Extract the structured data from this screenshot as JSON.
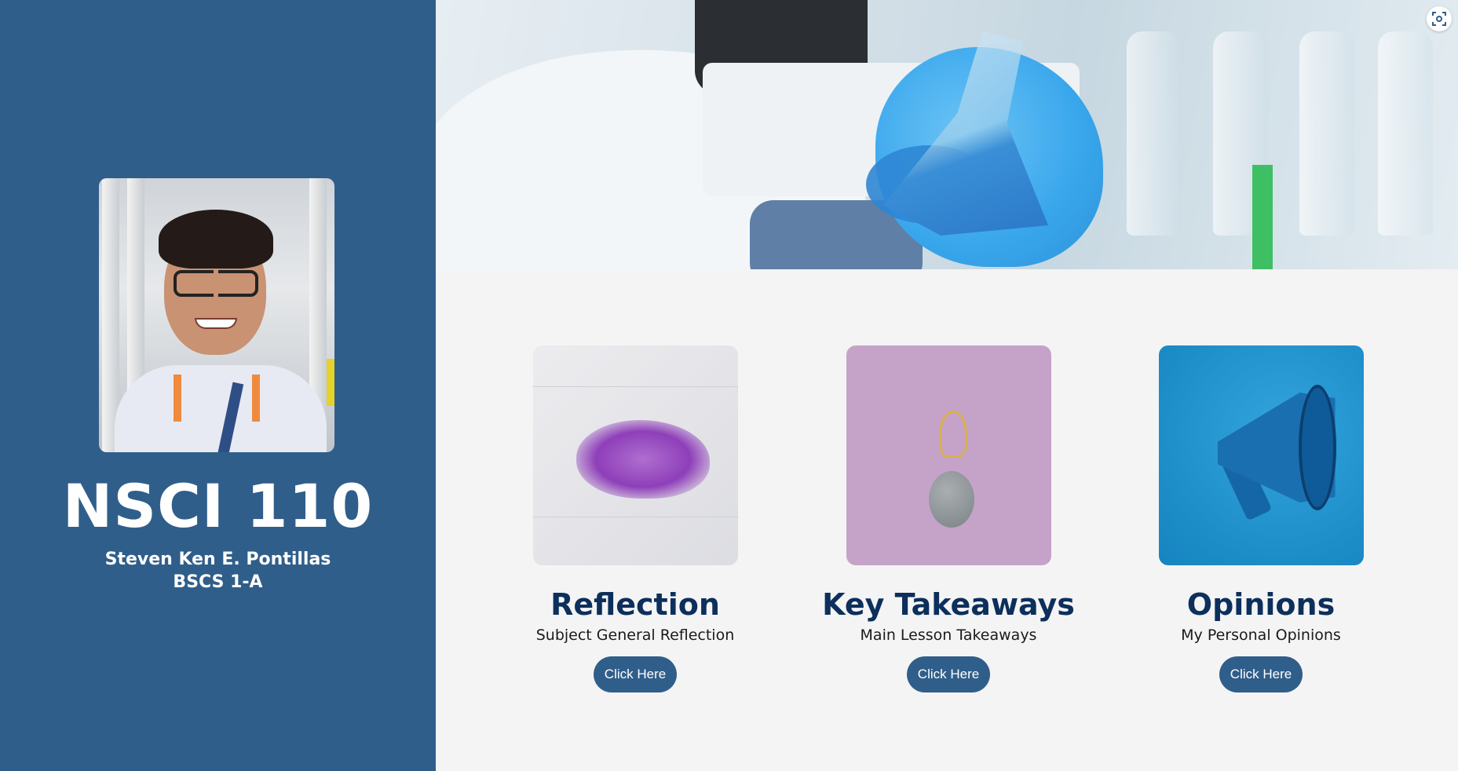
{
  "sidebar": {
    "course_title": "NSCI 110",
    "student_name": "Steven Ken E. Pontillas",
    "student_section": "BSCS 1-A"
  },
  "hero": {
    "scan_icon": "scan-icon"
  },
  "cards": [
    {
      "title": "Reflection",
      "subtitle": "Subject General Reflection",
      "button_label": "Click Here",
      "image": "brain-illustration"
    },
    {
      "title": "Key Takeaways",
      "subtitle": "Main Lesson Takeaways",
      "button_label": "Click Here",
      "image": "lightbulb-and-brain"
    },
    {
      "title": "Opinions",
      "subtitle": "My Personal Opinions",
      "button_label": "Click Here",
      "image": "megaphone"
    }
  ],
  "colors": {
    "sidebar_bg": "#305e8a",
    "page_bg": "#f4f4f4",
    "title_color": "#0c2f5c",
    "button_bg": "#305e8a"
  }
}
